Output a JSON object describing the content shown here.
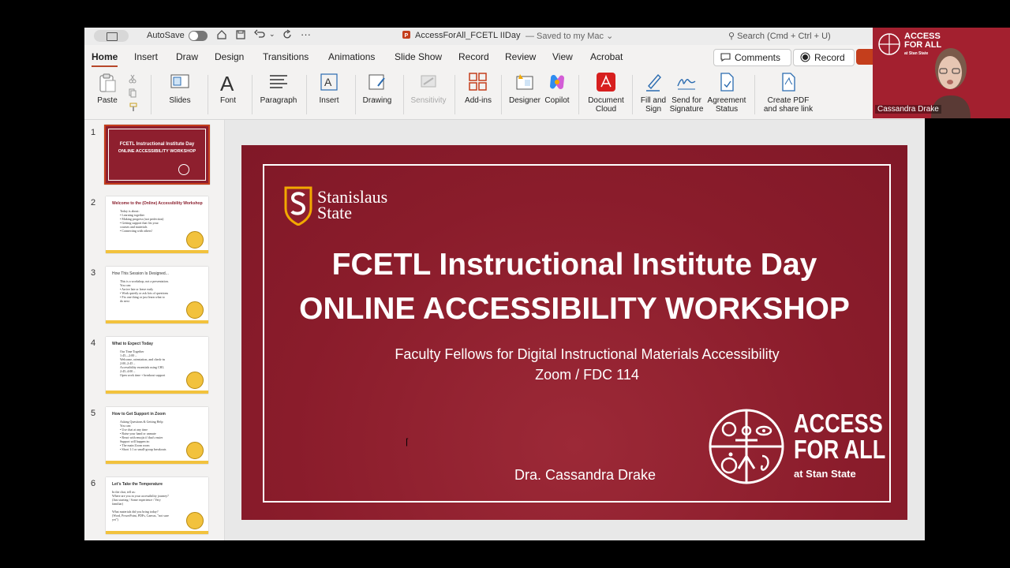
{
  "titlebar": {
    "autosave_label": "AutoSave",
    "document_title": "AccessForAll_FCETL IIDay",
    "save_status": "— Saved to my Mac ⌄",
    "search_placeholder": "Search (Cmd + Ctrl + U)"
  },
  "menu": {
    "tabs": [
      {
        "label": "Home",
        "active": true
      },
      {
        "label": "Insert"
      },
      {
        "label": "Draw"
      },
      {
        "label": "Design"
      },
      {
        "label": "Transitions"
      },
      {
        "label": "Animations"
      },
      {
        "label": "Slide Show"
      },
      {
        "label": "Record"
      },
      {
        "label": "Review"
      },
      {
        "label": "View"
      },
      {
        "label": "Acrobat"
      }
    ],
    "comments_label": "Comments",
    "record_label": "Record"
  },
  "ribbon": {
    "paste": "Paste",
    "slides": "Slides",
    "font": "Font",
    "paragraph": "Paragraph",
    "insert": "Insert",
    "drawing": "Drawing",
    "sensitivity": "Sensitivity",
    "addins": "Add-ins",
    "designer": "Designer",
    "copilot": "Copilot",
    "document_cloud": "Document\nCloud",
    "fill_sign": "Fill and\nSign",
    "send_signature": "Send for\nSignature",
    "agreement_status": "Agreement\nStatus",
    "create_pdf": "Create PDF\nand share link"
  },
  "thumbnails": [
    {
      "num": "1",
      "title": "FCETL Instructional Institute Day",
      "body": "ONLINE ACCESSIBILITY WORKSHOP"
    },
    {
      "num": "2",
      "title": "Welcome to the (Online) Accessibility Workshop",
      "body": "Today is about:\n• Learning together\n• Making progress (not perfection)\n• Getting support that fits your\n  courses and materials\n• Connecting with others!"
    },
    {
      "num": "3",
      "title": "How This Session Is Designed...",
      "body": "This is a workshop, not a presentation.\nYou can:\n• Arrive late or leave early\n• Work quietly or ask lots of questions\n• Fix one thing or just learn what to\n  do next"
    },
    {
      "num": "4",
      "title": "What to Expect Today",
      "body": "Our Time Together\n1:45—2:00 –\nWelcome, orientation, and check-in\n2:00–2:45 –\nAccessibility essentials using CHL\n2:45–4:00 –\nOpen work time + breakout support"
    },
    {
      "num": "5",
      "title": "How to Get Support in Zoom",
      "body": "Asking Questions & Getting Help\nYou can:\n• Use chat at any time\n• Raise your hand or unmute\n• React with emojis if that's easier\nSupport will happen in:\n• The main Zoom room\n• Short 1:1 or small-group breakouts"
    },
    {
      "num": "6",
      "title": "Let's Take the Temperature",
      "body": "In the chat, tell us:\nWhere are you in your accessibility journey?\n(Just starting / Some experience / Very\nfamiliar)\n\nWhat materials did you bring today?\n(Word, PowerPoint, PDFs, Canvas, \"not sure\nyet\")"
    }
  ],
  "slide": {
    "logo_text_line1": "Stanislaus",
    "logo_text_line2": "State",
    "title_line1": "FCETL Instructional Institute Day",
    "title_line2": "ONLINE ACCESSIBILITY WORKSHOP",
    "subtitle_line1": "Faculty Fellows for Digital Instructional Materials Accessibility",
    "subtitle_line2": "Zoom / FDC 114",
    "author": "Dra. Cassandra Drake",
    "afa_line1": "ACCESS",
    "afa_line2": "FOR ALL",
    "afa_sub": "at Stan State"
  },
  "video": {
    "participant_name": "Cassandra Drake",
    "afa_line1": "ACCESS",
    "afa_line2": "FOR ALL",
    "afa_sub": "at Stan State"
  },
  "colors": {
    "brand_red": "#8e1f2e",
    "accent_orange": "#c43e1c",
    "thumb_gold": "#f2c23d"
  }
}
